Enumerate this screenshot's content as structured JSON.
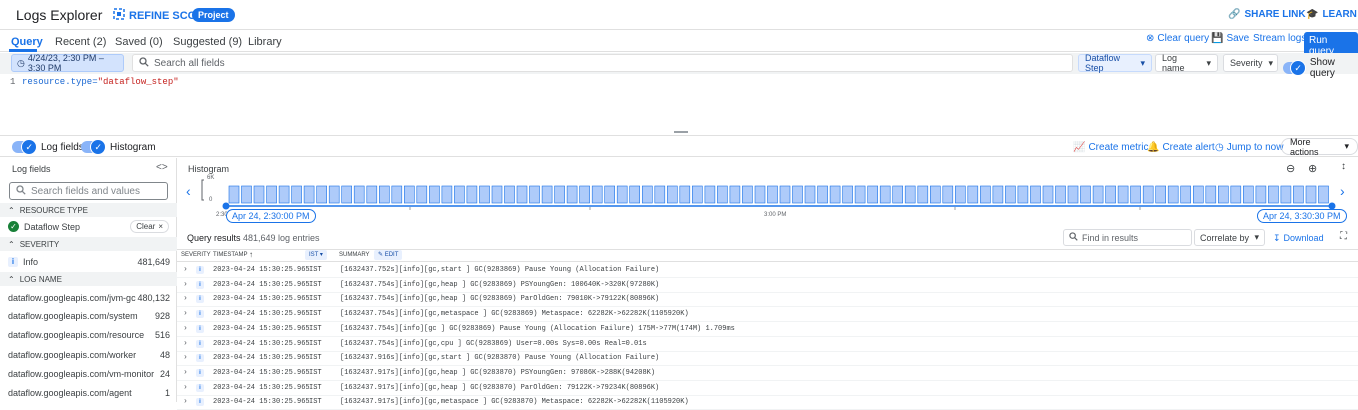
{
  "header": {
    "title": "Logs Explorer",
    "refine_scope": "REFINE SCOPE",
    "project_badge": "Project",
    "share_link": "SHARE LINK",
    "learn": "LEARN"
  },
  "tabs": [
    {
      "label": "Query",
      "active": true
    },
    {
      "label": "Recent (2)"
    },
    {
      "label": "Saved (0)"
    },
    {
      "label": "Suggested (9)"
    },
    {
      "label": "Library"
    }
  ],
  "query_tools": {
    "clear_query": "Clear query",
    "save": "Save",
    "stream_logs": "Stream logs",
    "run_query": "Run query"
  },
  "filters": {
    "time_range": "4/24/23, 2:30 PM – 3:30 PM",
    "search_placeholder": "Search all fields",
    "dataflow_step": "Dataflow Step",
    "log_name": "Log name",
    "severity": "Severity",
    "show_query": "Show query"
  },
  "editor": {
    "line_number": "1",
    "code_key": "resource.type=",
    "code_value": "\"dataflow_step\""
  },
  "options": {
    "log_fields": "Log fields",
    "histogram": "Histogram",
    "create_metric": "Create metric",
    "create_alert": "Create alert",
    "jump_to_now": "Jump to now",
    "more_actions": "More actions"
  },
  "sidebar": {
    "title": "Log fields",
    "search_placeholder": "Search fields and values",
    "resource_type_header": "RESOURCE TYPE",
    "resource_item": "Dataflow Step",
    "clear": "Clear",
    "severity_header": "SEVERITY",
    "severity_item": {
      "label": "Info",
      "count": "481,649"
    },
    "log_name_header": "LOG NAME",
    "log_names": [
      {
        "label": "dataflow.googleapis.com/jvm-gc",
        "count": "480,132"
      },
      {
        "label": "dataflow.googleapis.com/system",
        "count": "928"
      },
      {
        "label": "dataflow.googleapis.com/resource",
        "count": "516"
      },
      {
        "label": "dataflow.googleapis.com/worker",
        "count": "48"
      },
      {
        "label": "dataflow.googleapis.com/vm-monitor",
        "count": "24"
      },
      {
        "label": "dataflow.googleapis.com/agent",
        "count": "1"
      }
    ]
  },
  "histogram": {
    "title": "Histogram",
    "y_top": "6K",
    "y_bottom": "0",
    "start_label": "Apr 24, 2:30:00 PM",
    "mid_label": "3:00 PM",
    "end_label": "Apr 24, 3:30:30 PM",
    "start_tick": "2:30",
    "bar_count": 88,
    "bar_color": "#aecbfa",
    "bar_border": "#1a73e8"
  },
  "results": {
    "title": "Query results",
    "count": "481,649 log entries",
    "find_placeholder": "Find in results",
    "correlate": "Correlate by",
    "download": "Download",
    "columns": {
      "severity": "SEVERITY",
      "timestamp": "TIMESTAMP",
      "tz": "IST",
      "summary": "SUMMARY",
      "edit": "EDIT"
    },
    "rows": [
      {
        "ts": "2023-04-24 15:30:25.965",
        "tz": "IST",
        "summary": "[1632437.752s][info][gc,start ] GC(9283869) Pause Young (Allocation Failure)"
      },
      {
        "ts": "2023-04-24 15:30:25.965",
        "tz": "IST",
        "summary": "[1632437.754s][info][gc,heap ] GC(9283869) PSYoungGen: 100640K->320K(97280K)"
      },
      {
        "ts": "2023-04-24 15:30:25.965",
        "tz": "IST",
        "summary": "[1632437.754s][info][gc,heap ] GC(9283869) ParOldGen: 79010K->79122K(80896K)"
      },
      {
        "ts": "2023-04-24 15:30:25.965",
        "tz": "IST",
        "summary": "[1632437.754s][info][gc,metaspace ] GC(9283869) Metaspace: 62282K->62282K(1105920K)"
      },
      {
        "ts": "2023-04-24 15:30:25.965",
        "tz": "IST",
        "summary": "[1632437.754s][info][gc ] GC(9283869) Pause Young (Allocation Failure) 175M->77M(174M) 1.709ms"
      },
      {
        "ts": "2023-04-24 15:30:25.965",
        "tz": "IST",
        "summary": "[1632437.754s][info][gc,cpu ] GC(9283869) User=0.00s Sys=0.00s Real=0.01s"
      },
      {
        "ts": "2023-04-24 15:30:25.965",
        "tz": "IST",
        "summary": "[1632437.916s][info][gc,start ] GC(9283870) Pause Young (Allocation Failure)"
      },
      {
        "ts": "2023-04-24 15:30:25.965",
        "tz": "IST",
        "summary": "[1632437.917s][info][gc,heap ] GC(9283870) PSYoungGen: 97086K->288K(94208K)"
      },
      {
        "ts": "2023-04-24 15:30:25.965",
        "tz": "IST",
        "summary": "[1632437.917s][info][gc,heap ] GC(9283870) ParOldGen: 79122K->79234K(80896K)"
      },
      {
        "ts": "2023-04-24 15:30:25.965",
        "tz": "IST",
        "summary": "[1632437.917s][info][gc,metaspace ] GC(9283870) Metaspace: 62282K->62282K(1105920K)"
      }
    ]
  }
}
